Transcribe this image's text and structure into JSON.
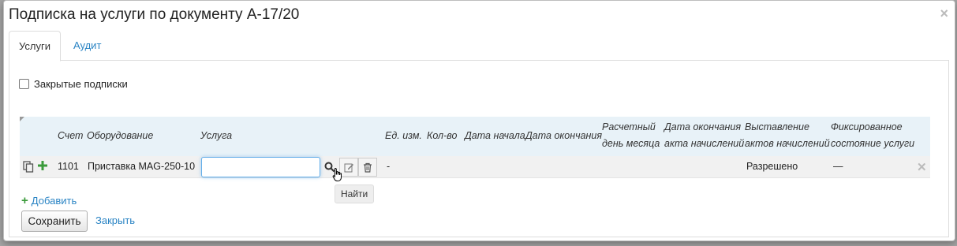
{
  "modal": {
    "title": "Подписка на услуги по документу А-17/20",
    "close_glyph": "×"
  },
  "tabs": [
    {
      "label": "Услуги",
      "active": true
    },
    {
      "label": "Аудит",
      "active": false
    }
  ],
  "closed_subscriptions": {
    "label": "Закрытые подписки",
    "checked": false
  },
  "grid": {
    "headers": {
      "account": "Счет",
      "equipment": "Оборудование",
      "service": "Услуга",
      "unit": "Ед. изм.",
      "qty": "Кол-во",
      "start_date": "Дата начала",
      "end_date": "Дата окончания",
      "billing_day_1": "Расчетный",
      "billing_day_2": "день месяца",
      "act_end_1": "Дата окончания",
      "act_end_2": "акта начислений",
      "billing_acts_1": "Выставление",
      "billing_acts_2": "актов начислений",
      "fixed_state_1": "Фиксированное",
      "fixed_state_2": "состояние услуги"
    },
    "rows": [
      {
        "account": "1101",
        "equipment": "Приставка MAG-250-10",
        "service": "",
        "unit": "-",
        "billing_acts": "Разрешено",
        "fixed_state": "—"
      }
    ]
  },
  "tooltip": "Найти",
  "actions": {
    "add_label": "Добавить",
    "save_label": "Сохранить",
    "close_label": "Закрыть"
  },
  "colors": {
    "link": "#2a84c4",
    "header_bg": "#e8f2f8",
    "add_green": "#3a9a3a"
  }
}
